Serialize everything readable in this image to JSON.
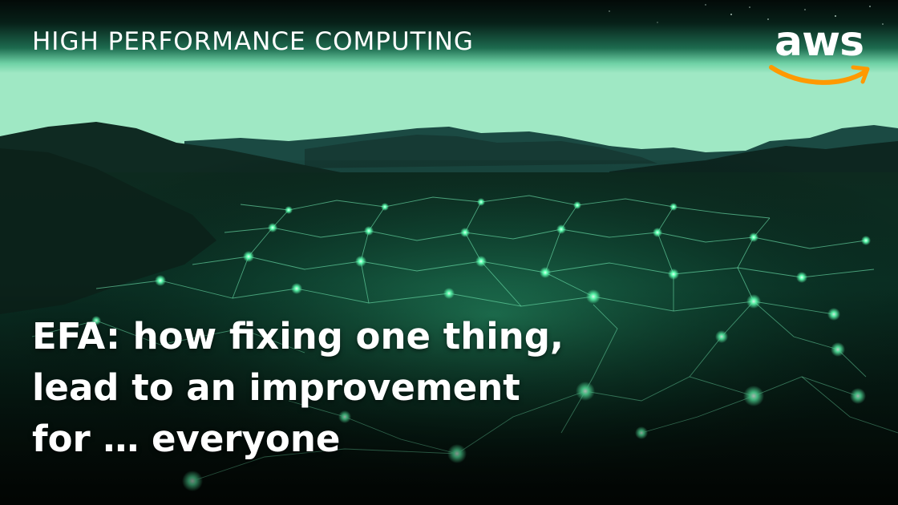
{
  "banner": {
    "eyebrow": "HIGH PERFORMANCE COMPUTING",
    "headline_lines": [
      "EFA: how fixing one thing,",
      "lead to an improvement",
      "for … everyone"
    ]
  },
  "logo": {
    "wordmark": "aws",
    "wordmark_color": "#ffffff",
    "smile_color": "#ff9900"
  },
  "scene": {
    "description_icon": "glowing-network-landscape",
    "sky_top": "#04120f",
    "sky_horizon": "#7fe0b2",
    "glow_color": "#5dffb0"
  }
}
